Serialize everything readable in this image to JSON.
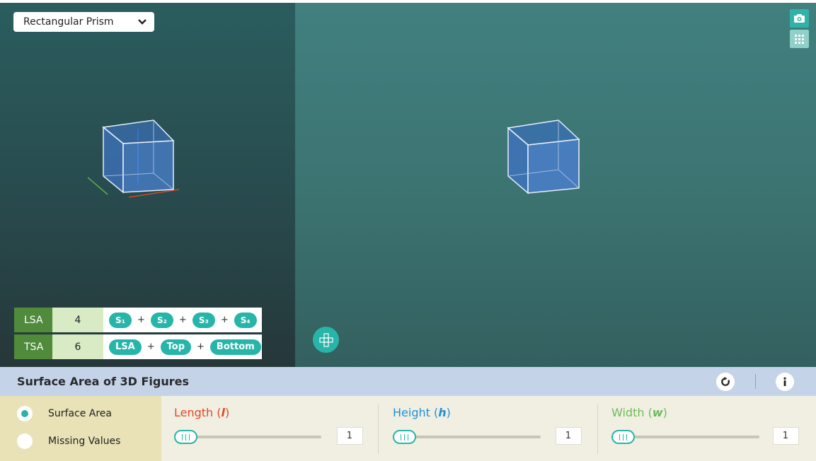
{
  "shape_selector": {
    "selected": "Rectangular Prism"
  },
  "toolbar": {
    "camera_icon": "camera-icon",
    "grid_icon": "grid-icon",
    "net_icon": "net-view-icon"
  },
  "formulas": {
    "lsa": {
      "label": "LSA",
      "value": "4",
      "terms": [
        "S₁",
        "S₂",
        "S₃",
        "S₄"
      ],
      "operator": "+"
    },
    "tsa": {
      "label": "TSA",
      "value": "6",
      "terms": [
        "LSA",
        "Top",
        "Bottom"
      ],
      "operator": "+"
    }
  },
  "panel": {
    "title": "Surface Area of 3D Figures",
    "reset_icon": "reset-icon",
    "info_icon": "info-icon"
  },
  "modes": [
    {
      "label": "Surface Area",
      "selected": true
    },
    {
      "label": "Missing Values",
      "selected": false
    }
  ],
  "sliders": {
    "length": {
      "label": "Length",
      "var": "l",
      "value": "1",
      "color": "#e2492a"
    },
    "height": {
      "label": "Height",
      "var": "h",
      "value": "1",
      "color": "#1f8fdc"
    },
    "width": {
      "label": "Width",
      "var": "w",
      "value": "1",
      "color": "#6dbb5a"
    }
  },
  "colors": {
    "accent": "#27b5a9",
    "lsa_label_bg": "#4f8b3a",
    "panel_header_bg": "#c5d3e9"
  }
}
